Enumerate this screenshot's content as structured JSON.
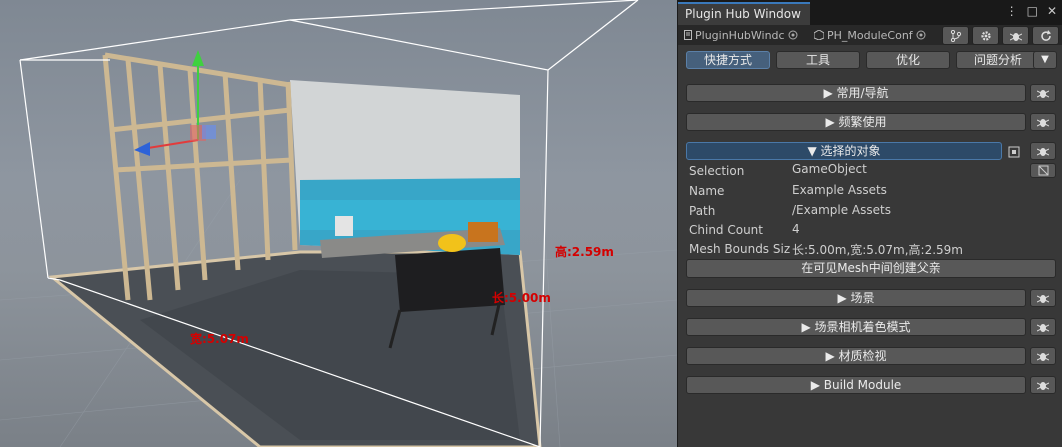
{
  "scene": {
    "labels": {
      "height": "高:2.59m",
      "length": "长:5.00m",
      "width": "宽:5.07m"
    }
  },
  "window": {
    "title": "Plugin Hub Window",
    "menu_icon": "⋮",
    "maximize_icon": "□",
    "close_icon": "✕"
  },
  "doc_tabs": [
    {
      "label": "PluginHubWindc"
    },
    {
      "label": "PH_ModuleConf"
    }
  ],
  "toolbar": {
    "branch_icon": "branch-icon",
    "gear_icon": "gear-icon",
    "bug_icon": "bug-icon",
    "refresh_icon": "refresh-icon"
  },
  "tabs": [
    {
      "label": "快捷方式",
      "active": true
    },
    {
      "label": "工具",
      "active": false
    },
    {
      "label": "优化",
      "active": false
    },
    {
      "label": "问题分析",
      "active": false
    }
  ],
  "tab_dropdown": "▼",
  "sections": {
    "common_nav": "▶ 常用/导航",
    "frequent": "▶ 频繁使用",
    "selected": "▼ 选择的对象",
    "scene": "▶ 场景",
    "camera_shading": "▶ 场景相机着色模式",
    "material": "▶ 材质检视",
    "build": "▶ Build Module"
  },
  "properties": [
    {
      "label": "Selection",
      "value": "GameObject"
    },
    {
      "label": "Name",
      "value": "Example Assets"
    },
    {
      "label": "Path",
      "value": "/Example Assets"
    },
    {
      "label": "Chind Count",
      "value": "4"
    },
    {
      "label": "Mesh Bounds Siz",
      "value": "长:5.00m,宽:5.07m,高:2.59m"
    }
  ],
  "create_parent_button": "在可见Mesh中间创建父亲",
  "colors": {
    "accent": "#3a79bb",
    "active_tab": "#46607c",
    "open_section": "#2d4a68",
    "dimension_label": "#d40000"
  }
}
